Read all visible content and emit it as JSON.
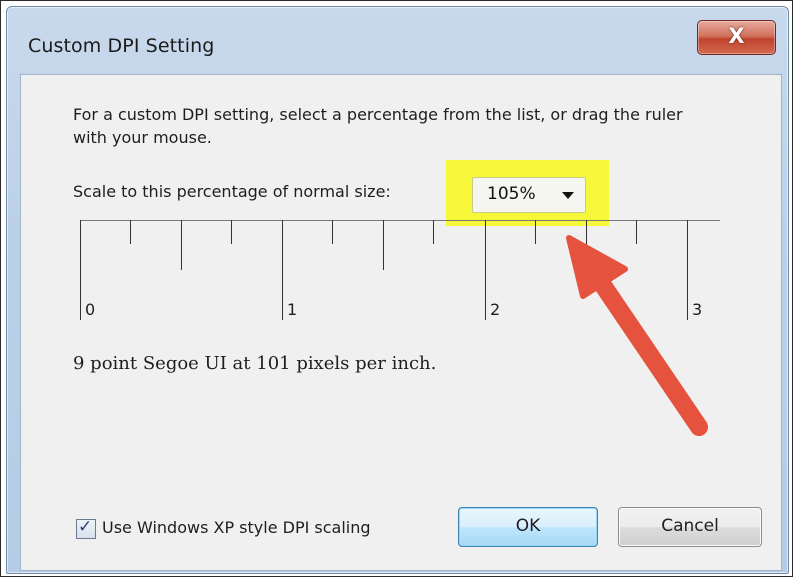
{
  "window": {
    "title": "Custom DPI Setting",
    "close_glyph": "X"
  },
  "dialog": {
    "description": "For a custom DPI setting, select a percentage from the list, or drag the ruler with your mouse.",
    "scale_label": "Scale to this percentage of normal size:",
    "scale_value": "105%",
    "ruler_labels": [
      "0",
      "1",
      "2",
      "3"
    ],
    "info_text": "9 point Segoe UI at 101 pixels per inch.",
    "checkbox_label": "Use Windows XP style DPI scaling",
    "checkbox_checked": true,
    "ok_label": "OK",
    "cancel_label": "Cancel"
  },
  "annotations": {
    "highlight_color": "#f7f73a",
    "arrow_color": "#e5533f"
  }
}
